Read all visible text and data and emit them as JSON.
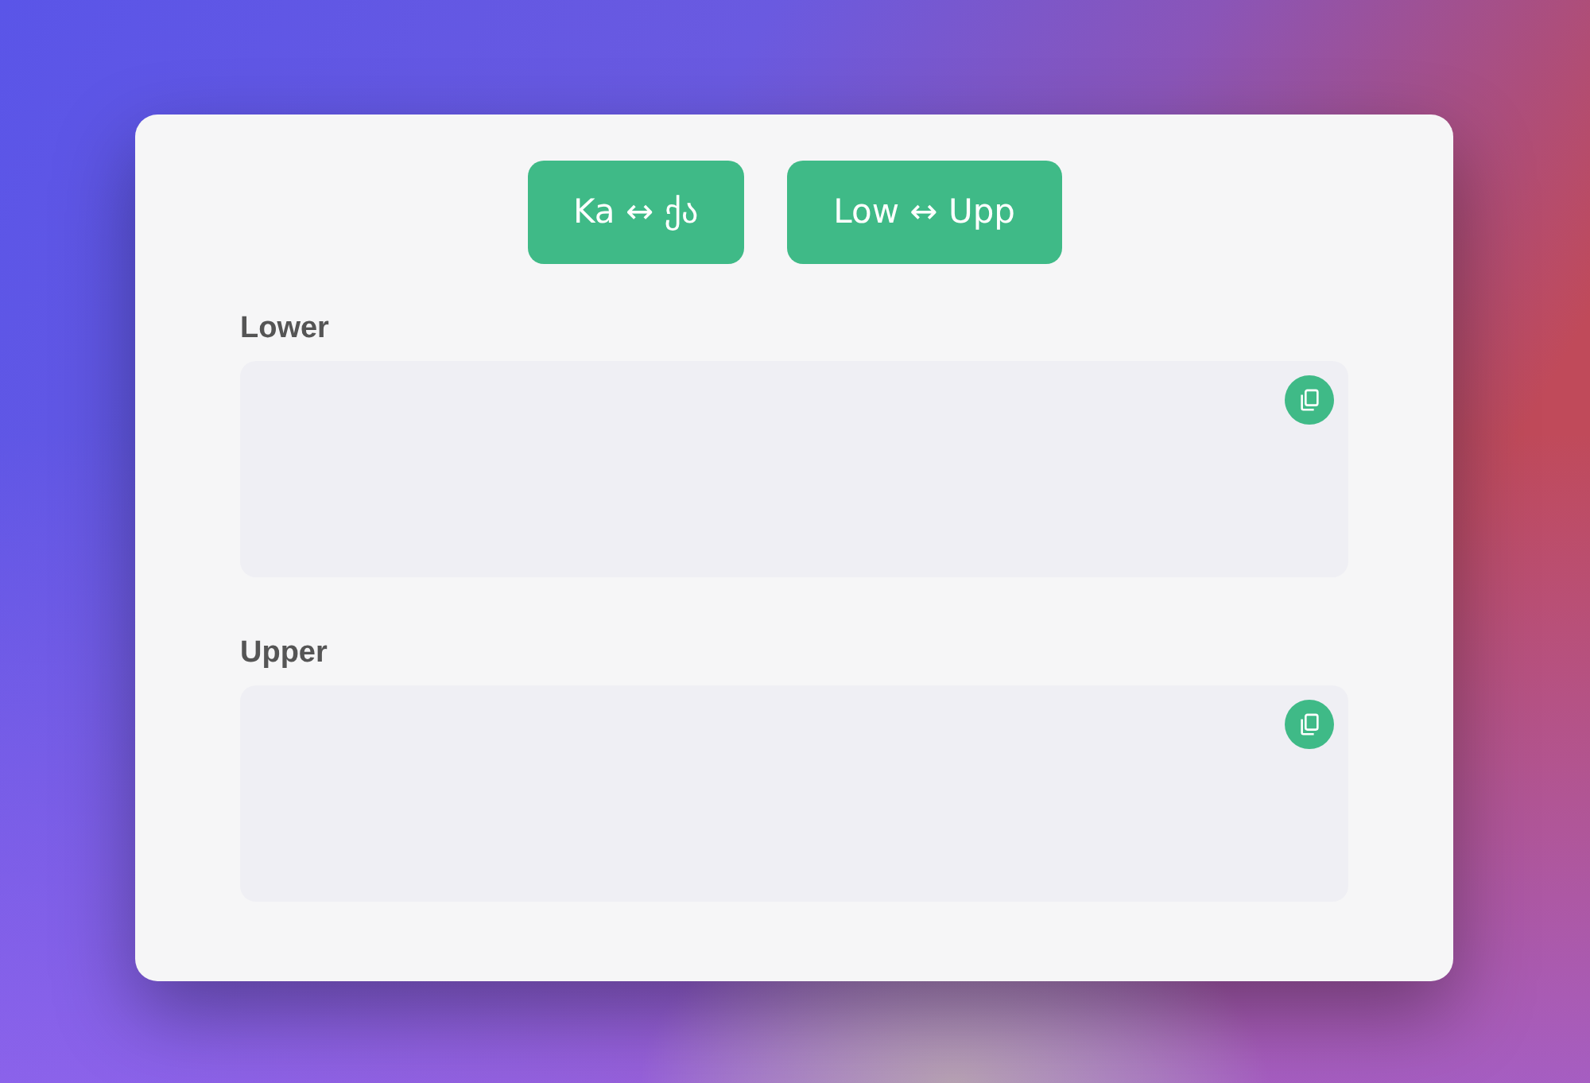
{
  "buttons": [
    {
      "label": "Ka ↔ ქა"
    },
    {
      "label": "Low ↔ Upp"
    }
  ],
  "fields": [
    {
      "label": "Lower"
    },
    {
      "label": "Upper"
    }
  ]
}
